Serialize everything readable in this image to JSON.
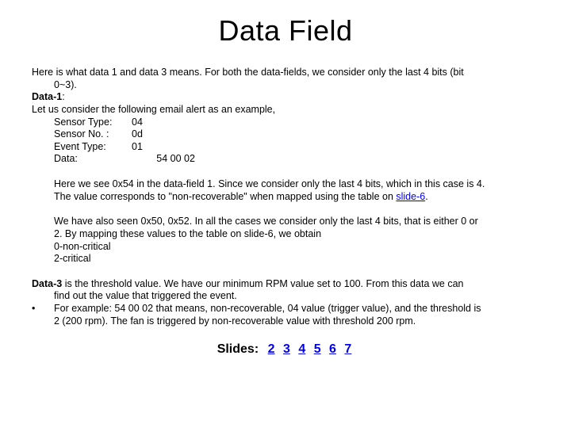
{
  "title": "Data Field",
  "intro": "Here is what data 1 and data 3 means. For both the data-fields, we consider only the last 4 bits (bit",
  "intro_cont": "0~3).",
  "data1_label": "Data-1",
  "data1_colon": ":",
  "data1_example_intro": "Let us consider the following email alert as an example,",
  "sensor_rows": [
    {
      "label": "Sensor Type:",
      "value": "04"
    },
    {
      "label": "Sensor No. :",
      "value": "0d"
    },
    {
      "label": "Event Type:",
      "value": "01"
    },
    {
      "label": "Data:",
      "value": "         54 00 02"
    }
  ],
  "para_054_a": "Here we see 0x54 in the data-field 1. Since we consider only the last 4 bits, which in this case is 4.",
  "para_054_b_pre": "The value corresponds to \"non-recoverable\" when mapped using the table on ",
  "para_054_link": "slide-6",
  "para_054_b_post": ".",
  "para_050_a": "We have also seen 0x50, 0x52. In all the cases we consider only the last 4 bits, that is either 0 or",
  "para_050_b": "2. By mapping these values to the table on slide-6, we obtain",
  "map_0": "0-non-critical",
  "map_2": "2-critical",
  "data3_label": "Data-3",
  "data3_sentence_pre": " is the threshold value. We have our minimum RPM value set to 100. From this data we can",
  "data3_sentence_b": "find out the value that triggered the event.",
  "data3_example_a": "For example: 54 00 02 that means, non-recoverable, 04 value (trigger value), and the threshold is",
  "data3_example_b": "2 (200 rpm). The fan is triggered by non-recoverable value with threshold 200 rpm.",
  "nav_label": "Slides:",
  "nav_items": [
    "2",
    "3",
    "4",
    "5",
    "6",
    "7"
  ]
}
